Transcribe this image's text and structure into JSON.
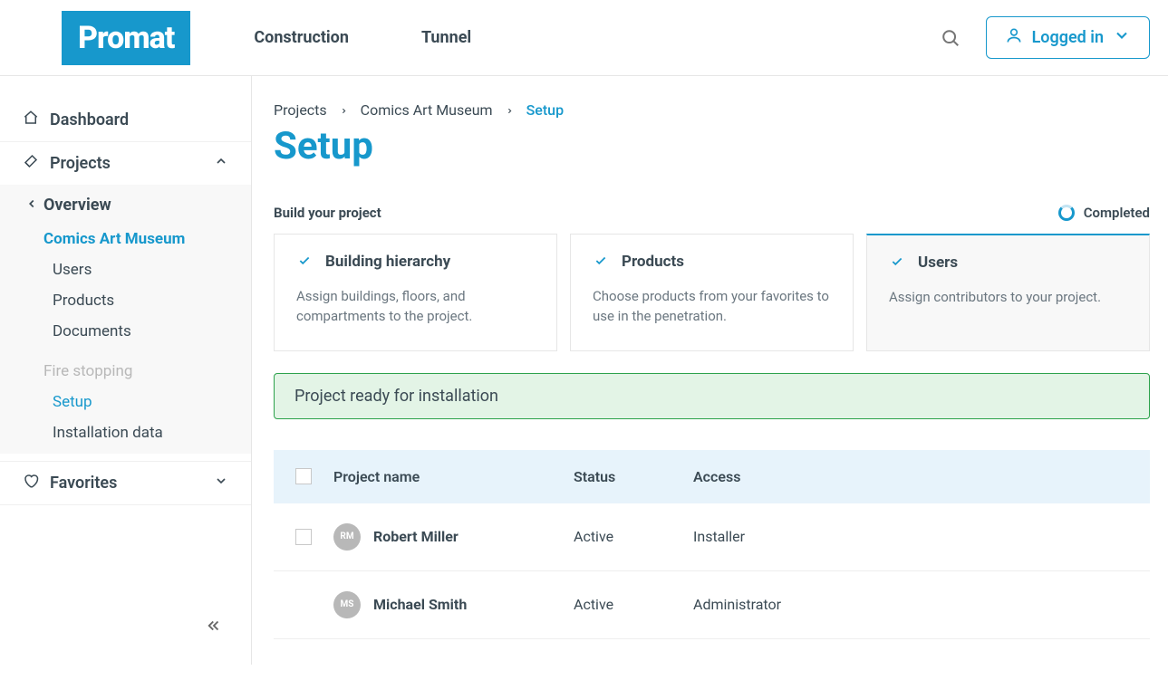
{
  "header": {
    "logo": "Promat",
    "nav": {
      "construction": "Construction",
      "tunnel": "Tunnel"
    },
    "logged_in": "Logged in"
  },
  "sidebar": {
    "dashboard": "Dashboard",
    "projects": "Projects",
    "overview": "Overview",
    "items": {
      "comics": "Comics Art Museum",
      "users": "Users",
      "products": "Products",
      "documents": "Documents",
      "fire_stopping": "Fire stopping",
      "setup": "Setup",
      "installation_data": "Installation data"
    },
    "favorites": "Favorites"
  },
  "breadcrumb": {
    "projects": "Projects",
    "comics": "Comics Art Museum",
    "setup": "Setup"
  },
  "page_title": "Setup",
  "subtitle": "Build your project",
  "completed": "Completed",
  "cards": {
    "hierarchy": {
      "title": "Building hierarchy",
      "desc": "Assign buildings, floors, and compartments to the project."
    },
    "products": {
      "title": "Products",
      "desc": "Choose products from your favorites to use in the penetration."
    },
    "users": {
      "title": "Users",
      "desc": "Assign contributors to your project."
    }
  },
  "ready_banner": "Project ready for installation",
  "table": {
    "headers": {
      "name": "Project name",
      "status": "Status",
      "access": "Access"
    },
    "rows": [
      {
        "initials": "RM",
        "name": "Robert Miller",
        "status": "Active",
        "access": "Installer",
        "checkbox": true
      },
      {
        "initials": "MS",
        "name": "Michael Smith",
        "status": "Active",
        "access": "Administrator",
        "checkbox": false
      }
    ]
  }
}
